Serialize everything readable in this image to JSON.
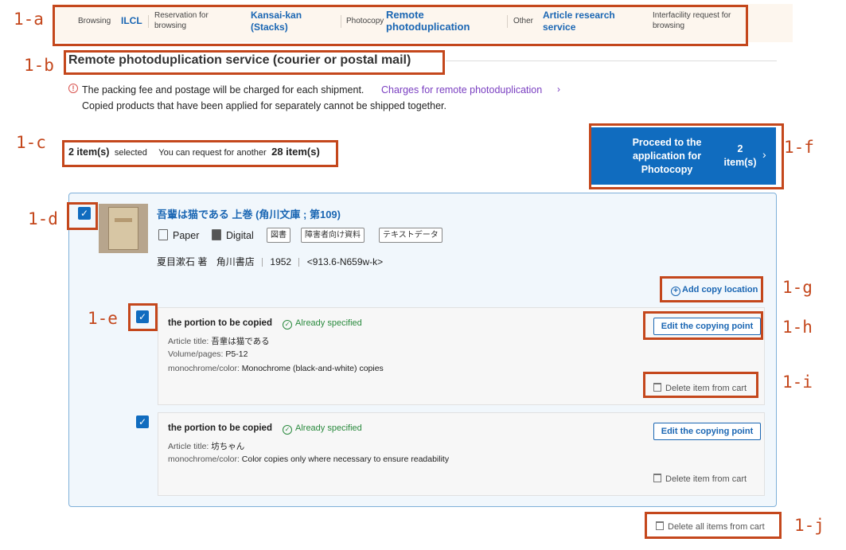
{
  "annotations": [
    "1-a",
    "1-b",
    "1-c",
    "1-d",
    "1-e",
    "1-f",
    "1-g",
    "1-h",
    "1-i",
    "1-j"
  ],
  "tabs": {
    "browsing_label": "Browsing",
    "browsing_link": "ILCL",
    "reservation_label": "Reservation for browsing",
    "reservation_link": "Kansai-kan (Stacks)",
    "photocopy_label": "Photocopy",
    "photocopy_link": "Remote photoduplication",
    "other_label": "Other",
    "other_link": "Article research service",
    "interfacility_label": "Interfacility request for browsing"
  },
  "section_title": "Remote photoduplication service (courier or postal mail)",
  "notice": {
    "line1": "The packing fee and postage will be charged for each shipment.",
    "link": "Charges for remote photoduplication",
    "line2": "Copied products that have been applied for separately cannot be shipped together."
  },
  "selection": {
    "count": "2 item(s)",
    "selected_label": "selected",
    "remaining_prefix": "You can request for another",
    "remaining": "28 item(s)"
  },
  "proceed": {
    "label": "Proceed to the application for Photocopy",
    "count": "2 item(s)"
  },
  "book": {
    "title": "吾輩は猫である 上巻 (角川文庫 ; 第109)",
    "media_paper": "Paper",
    "media_digital": "Digital",
    "tags": [
      "図書",
      "障害者向け資料",
      "テキストデータ"
    ],
    "author": "夏目漱石 著",
    "publisher": "角川書店",
    "year": "1952",
    "call_number": "<913.6-N659w-k>",
    "add_copy_location": "Add copy location"
  },
  "copy_items": [
    {
      "heading": "the portion to be copied",
      "status": "Already specified",
      "article_title_label": "Article title:",
      "article_title": "吾輩は猫である",
      "volume_label": "Volume/pages:",
      "volume": "P5-12",
      "color_label": "monochrome/color:",
      "color": "Monochrome (black-and-white) copies",
      "edit_label": "Edit the copying point",
      "delete_label": "Delete item from cart"
    },
    {
      "heading": "the portion to be copied",
      "status": "Already specified",
      "article_title_label": "Article title:",
      "article_title": "坊ちゃん",
      "color_label": "monochrome/color:",
      "color": "Color copies only where necessary to ensure readability",
      "edit_label": "Edit the copying point",
      "delete_label": "Delete item from cart"
    }
  ],
  "delete_all_label": "Delete all items from cart",
  "colors": {
    "callout": "#c4471c",
    "primary": "#106cbf",
    "link": "#1a66b3",
    "visited_link": "#7a3fc1",
    "success": "#2a8a3e",
    "card_bg": "#f1f7fc",
    "tab_bg": "#fdf6ee"
  }
}
